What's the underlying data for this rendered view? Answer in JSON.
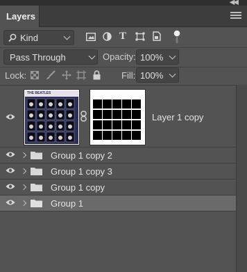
{
  "panel": {
    "title": "Layers",
    "collapse_icon": "double-chevron-icon",
    "menu_icon": "panel-menu-icon"
  },
  "filter": {
    "kind_label": "Kind",
    "icons": [
      "image-filter-icon",
      "adjustment-filter-icon",
      "type-filter-icon",
      "shape-filter-icon",
      "smart-object-filter-icon",
      "filter-toggle-icon"
    ]
  },
  "blend": {
    "mode": "Pass Through",
    "opacity_label": "Opacity:",
    "opacity_value": "100%"
  },
  "lock": {
    "label": "Lock:",
    "fill_label": "Fill:",
    "fill_value": "100%",
    "icons": [
      "lock-transparent-icon",
      "lock-pixels-icon",
      "lock-position-icon",
      "lock-artboard-icon",
      "lock-all-icon"
    ]
  },
  "layers": [
    {
      "name": "Layer 1 copy",
      "type": "layer",
      "visible": true,
      "selected": false
    },
    {
      "name": "Group 1 copy 2",
      "type": "group",
      "visible": true,
      "selected": false
    },
    {
      "name": "Group 1 copy 3",
      "type": "group",
      "visible": true,
      "selected": false
    },
    {
      "name": "Group 1 copy",
      "type": "group",
      "visible": true,
      "selected": false
    },
    {
      "name": "Group 1",
      "type": "group",
      "visible": true,
      "selected": true
    }
  ],
  "thumbnail": {
    "header_text": "THE BEATLES",
    "mask_grid": {
      "rows": 4,
      "cols": 5
    }
  },
  "colors": {
    "panel_bg": "#535353",
    "selected_row": "#696969",
    "field_bg": "#454545"
  }
}
